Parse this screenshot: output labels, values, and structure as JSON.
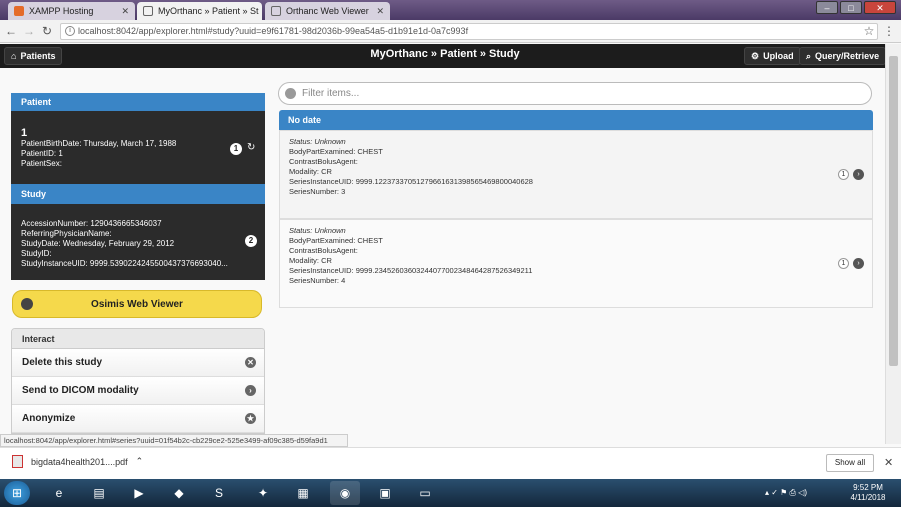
{
  "browser": {
    "tabs": [
      {
        "label": "XAMPP Hosting",
        "active": false
      },
      {
        "label": "MyOrthanc » Patient » St",
        "active": true
      },
      {
        "label": "Orthanc Web Viewer",
        "active": false
      }
    ],
    "url": "localhost:8042/app/explorer.html#study?uuid=e9f61781-98d2036b-99ea54a5-d1b91e1d-0a7c993f",
    "status_url": "localhost:8042/app/explorer.html#series?uuid=01f54b2c-cb229ce2-525e3499-af09c385-d59fa9d1"
  },
  "app": {
    "patients_btn": "Patients",
    "title": "MyOrthanc » Patient » Study",
    "upload_btn": "Upload",
    "query_btn": "Query/Retrieve"
  },
  "patient": {
    "header": "Patient",
    "name": "1",
    "rows": [
      "PatientBirthDate: Thursday, March 17, 1988",
      "PatientID: 1",
      "PatientSex:"
    ],
    "badge": "1"
  },
  "study": {
    "header": "Study",
    "rows": [
      "AccessionNumber: 1290436665346037",
      "ReferringPhysicianName:",
      "StudyDate: Wednesday, February 29, 2012",
      "StudyID:",
      "StudyInstanceUID: 9999.5390224245500437376693040..."
    ],
    "badge": "2"
  },
  "osimis_label": "Osimis Web Viewer",
  "interact": {
    "header": "Interact",
    "items": [
      "Delete this study",
      "Send to DICOM modality",
      "Anonymize"
    ]
  },
  "filter_placeholder": "Filter items...",
  "series_header": "No date",
  "series": [
    {
      "status": "Status: Unknown",
      "rows": [
        "BodyPartExamined: CHEST",
        "ContrastBolusAgent:",
        "Modality: CR",
        "SeriesInstanceUID: 9999.12237337051279661631398565469800040628",
        "SeriesNumber: 3"
      ],
      "count": "1"
    },
    {
      "status": "Status: Unknown",
      "rows": [
        "BodyPartExamined: CHEST",
        "ContrastBolusAgent:",
        "Modality: CR",
        "SeriesInstanceUID: 9999.23452603603244077002348464287526349211",
        "SeriesNumber: 4"
      ],
      "count": "1"
    }
  ],
  "downloads": {
    "file": "bigdata4health201....pdf",
    "show_all": "Show all"
  },
  "clock": {
    "time": "9:52 PM",
    "date": "4/11/2018"
  }
}
